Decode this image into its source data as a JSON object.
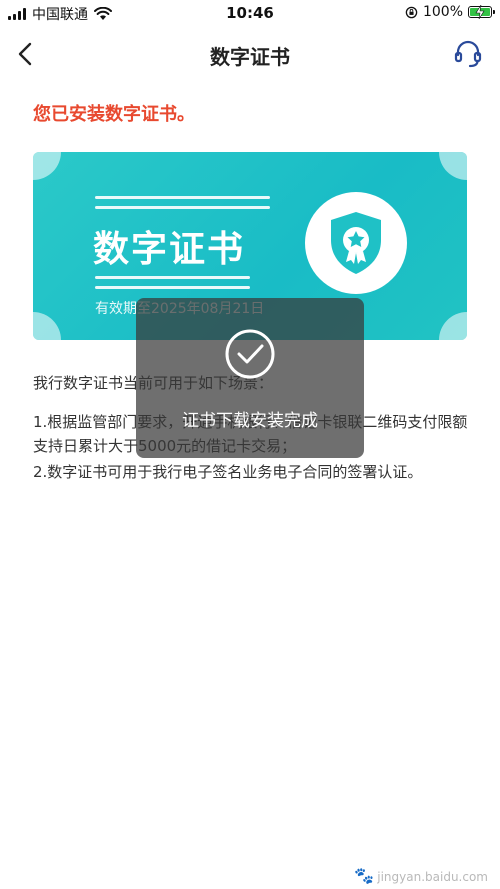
{
  "status_bar": {
    "carrier": "中国联通",
    "time": "10:46",
    "battery": "100%",
    "battery_level": 1.0,
    "battery_color": "#33c245"
  },
  "nav": {
    "title": "数字证书",
    "back_icon": "chevron-left-icon",
    "service_icon": "headset-icon"
  },
  "installed_message": "您已安装数字证书。",
  "certificate": {
    "title": "数字证书",
    "expiry": "有效期至2025年08月21日",
    "badge_icon": "shield-badge-icon",
    "color": "#1fc1c6"
  },
  "description": {
    "intro": "我行数字证书当前可用于如下场景：",
    "rule_1": "1.根据监管部门要求，开通手机银行、借记卡银联二维码支付限额支持日累计大于5000元的借记卡交易；",
    "rule_2": "2.数字证书可用于我行电子签名业务电子合同的签署认证。"
  },
  "toast": {
    "icon": "check-circle-icon",
    "message": "证书下载安装完成"
  },
  "watermark": {
    "text": "jingyan.baidu.com"
  },
  "colors": {
    "accent_red": "#e8492f",
    "toast_bg": "rgba(55,55,55,0.72)"
  }
}
